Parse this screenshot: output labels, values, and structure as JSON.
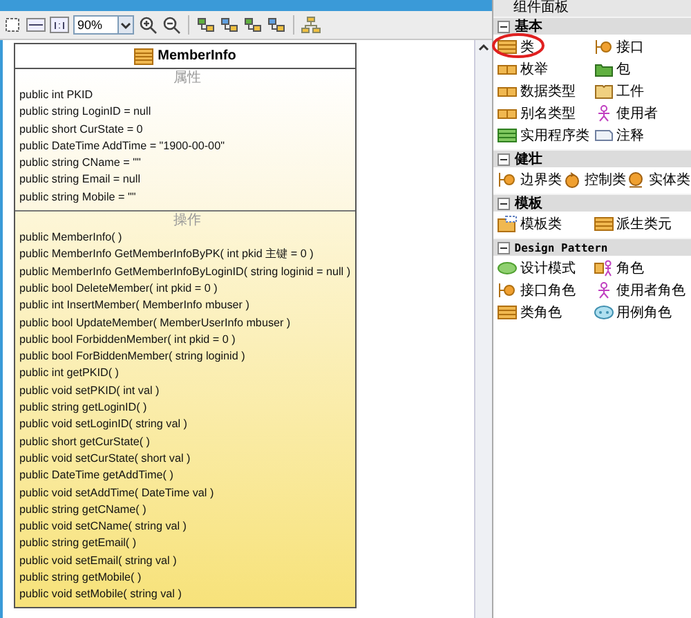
{
  "toolbar": {
    "zoom": "90%"
  },
  "class_box": {
    "name": "MemberInfo",
    "attributes_label": "属性",
    "attributes": [
      "public int PKID",
      "public string LoginID = null",
      "public short CurState = 0",
      "public DateTime AddTime = \"1900-00-00\"",
      "public string CName = \"\"",
      "public string Email = null",
      "public string Mobile = \"\""
    ],
    "operations_label": "操作",
    "operations": [
      "public MemberInfo(  )",
      "public MemberInfo  GetMemberInfoByPK( int   pkid 主键 = 0 )",
      "public MemberInfo  GetMemberInfoByLoginID( string loginid = null )",
      "public bool  DeleteMember( int pkid = 0 )",
      "public int  InsertMember( MemberInfo mbuser )",
      "public bool  UpdateMember( MemberUserInfo mbuser )",
      "public bool  ForbiddenMember( int pkid = 0 )",
      "public bool  ForBiddenMember( string loginid )",
      "public int  getPKID(  )",
      "public void  setPKID( int val )",
      "public string  getLoginID(  )",
      "public void  setLoginID( string val )",
      "public short  getCurState(  )",
      "public void  setCurState( short val )",
      "public DateTime  getAddTime(  )",
      "public void  setAddTime( DateTime val )",
      "public string  getCName(  )",
      "public void  setCName( string val )",
      "public string  getEmail(  )",
      "public void  setEmail( string val )",
      "public string  getMobile(  )",
      "public void  setMobile( string val )"
    ]
  },
  "palette": {
    "title": "组件面板",
    "sections": [
      {
        "title": "基本",
        "expanded": true,
        "items": [
          {
            "label": "类",
            "kind": "class",
            "highlighted": true
          },
          {
            "label": "接口",
            "kind": "interface",
            "highlighted": false
          },
          {
            "label": "枚举",
            "kind": "enum",
            "highlighted": false
          },
          {
            "label": "包",
            "kind": "package",
            "highlighted": false
          },
          {
            "label": "数据类型",
            "kind": "enum",
            "highlighted": false
          },
          {
            "label": "工件",
            "kind": "artifact",
            "highlighted": false
          },
          {
            "label": "别名类型",
            "kind": "enum",
            "highlighted": false
          },
          {
            "label": "使用者",
            "kind": "actor",
            "highlighted": false
          },
          {
            "label": "实用程序类",
            "kind": "utility",
            "highlighted": false
          },
          {
            "label": "注释",
            "kind": "note",
            "highlighted": false
          }
        ]
      },
      {
        "title": "健壮",
        "expanded": true,
        "items": [
          {
            "label": "边界类",
            "kind": "interface",
            "highlighted": false
          },
          {
            "label": "控制类",
            "kind": "control",
            "highlighted": false
          },
          {
            "label": "实体类",
            "kind": "entity",
            "highlighted": false
          }
        ]
      },
      {
        "title": "模板",
        "expanded": true,
        "items": [
          {
            "label": "模板类",
            "kind": "template",
            "highlighted": false
          },
          {
            "label": "派生类元",
            "kind": "class",
            "highlighted": false
          }
        ]
      },
      {
        "title": "Design Pattern",
        "expanded": true,
        "items": [
          {
            "label": "设计模式",
            "kind": "pattern",
            "highlighted": false
          },
          {
            "label": "角色",
            "kind": "role",
            "highlighted": false
          },
          {
            "label": "接口角色",
            "kind": "interface",
            "highlighted": false
          },
          {
            "label": "使用者角色",
            "kind": "actor",
            "highlighted": false
          },
          {
            "label": "类角色",
            "kind": "class",
            "highlighted": false
          },
          {
            "label": "用例角色",
            "kind": "usecase",
            "highlighted": false
          }
        ]
      }
    ]
  }
}
